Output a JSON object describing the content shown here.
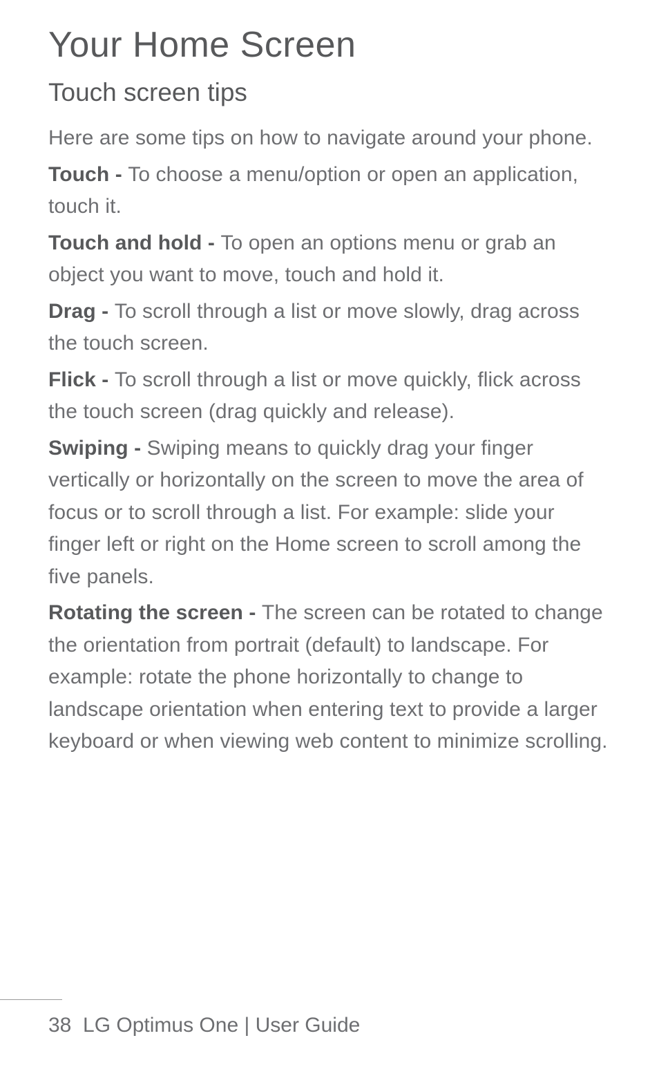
{
  "heading": "Your Home Screen",
  "subheading": "Touch screen tips",
  "intro": "Here are some tips on how to navigate around your phone.",
  "tips": {
    "touch": {
      "label": "Touch - ",
      "text": "To choose a menu/option or open an application, touch it."
    },
    "touch_hold": {
      "label": "Touch and hold - ",
      "text": "To open an options menu or grab an object you want to move, touch and hold it."
    },
    "drag": {
      "label": "Drag - ",
      "text": "To scroll through a list or move slowly,  drag across the touch screen."
    },
    "flick": {
      "label": "Flick - ",
      "text": "To scroll through a list or move quickly, flick across the touch screen (drag quickly and release)."
    },
    "swiping": {
      "label": "Swiping - ",
      "text": "Swiping means to quickly drag your finger vertically or horizontally on the screen to move the area of focus or to scroll through a list. For example: slide your finger left or right on the Home screen to scroll among the five panels."
    },
    "rotating": {
      "label": "Rotating the screen - ",
      "text": "The screen can be rotated to change the orientation from portrait (default) to landscape. For example: rotate the phone horizontally to change to landscape orientation when entering text to provide a larger keyboard or when viewing web content to minimize scrolling."
    }
  },
  "footer": {
    "page_number": "38",
    "product": "LG Optimus One",
    "separator": "  |  ",
    "doc_type": "User Guide"
  }
}
